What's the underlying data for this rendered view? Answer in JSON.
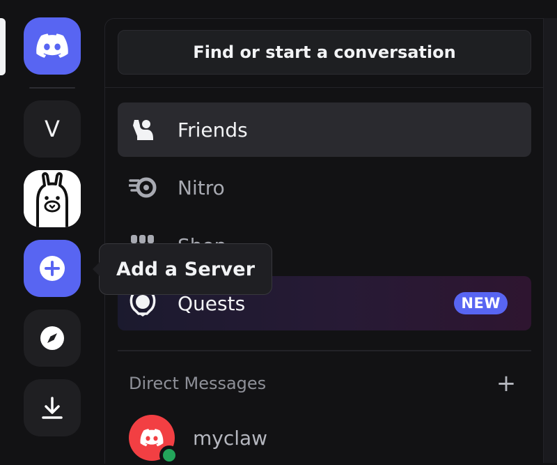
{
  "search": {
    "label": "Find or start a conversation"
  },
  "rail": {
    "v_server_initial": "V",
    "tooltip": "Add a Server",
    "icons": [
      "discord-logo-icon",
      "ollama-llama-icon",
      "plus-circle-icon",
      "compass-icon",
      "download-icon"
    ]
  },
  "nav": {
    "friends": "Friends",
    "nitro": "Nitro",
    "shop": "Shop",
    "quests": "Quests",
    "quests_badge": "NEW"
  },
  "dms": {
    "header": "Direct Messages",
    "add_symbol": "+",
    "users": [
      {
        "name": "myclaw",
        "status": "online"
      }
    ]
  },
  "colors": {
    "accent": "#5865f2",
    "avatar_red": "#f23f43",
    "online": "#23a55a",
    "bg": "#121214"
  }
}
